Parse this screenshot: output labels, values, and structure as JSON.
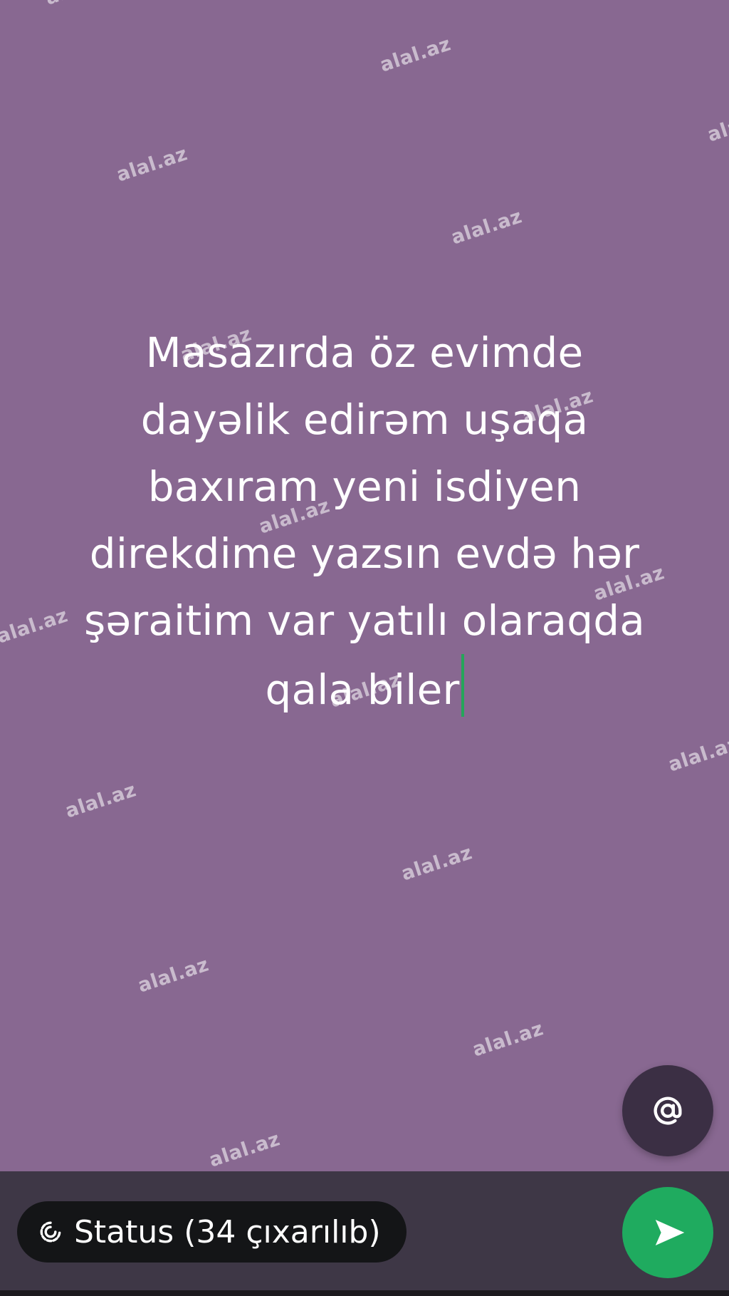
{
  "app": {
    "screen": "status-text-composer"
  },
  "status": {
    "text": "Masazırda öz evimde\ndayəlik edirəm uşaqa\nbaxıram yeni isdiyen\ndirekdime yazsın evdə hər\nşəraitim var yatılı olaraqda\nqala biler",
    "background_color": "#886891",
    "text_color": "#ffffff"
  },
  "watermark": {
    "text": "alal.az"
  },
  "mention_button": {
    "icon": "at-icon"
  },
  "bottom_bar": {
    "privacy_label": "Status (34 çıxarılıb)",
    "privacy_icon": "status-privacy-icon",
    "send_icon": "send-icon",
    "send_color": "#1fab5f"
  }
}
